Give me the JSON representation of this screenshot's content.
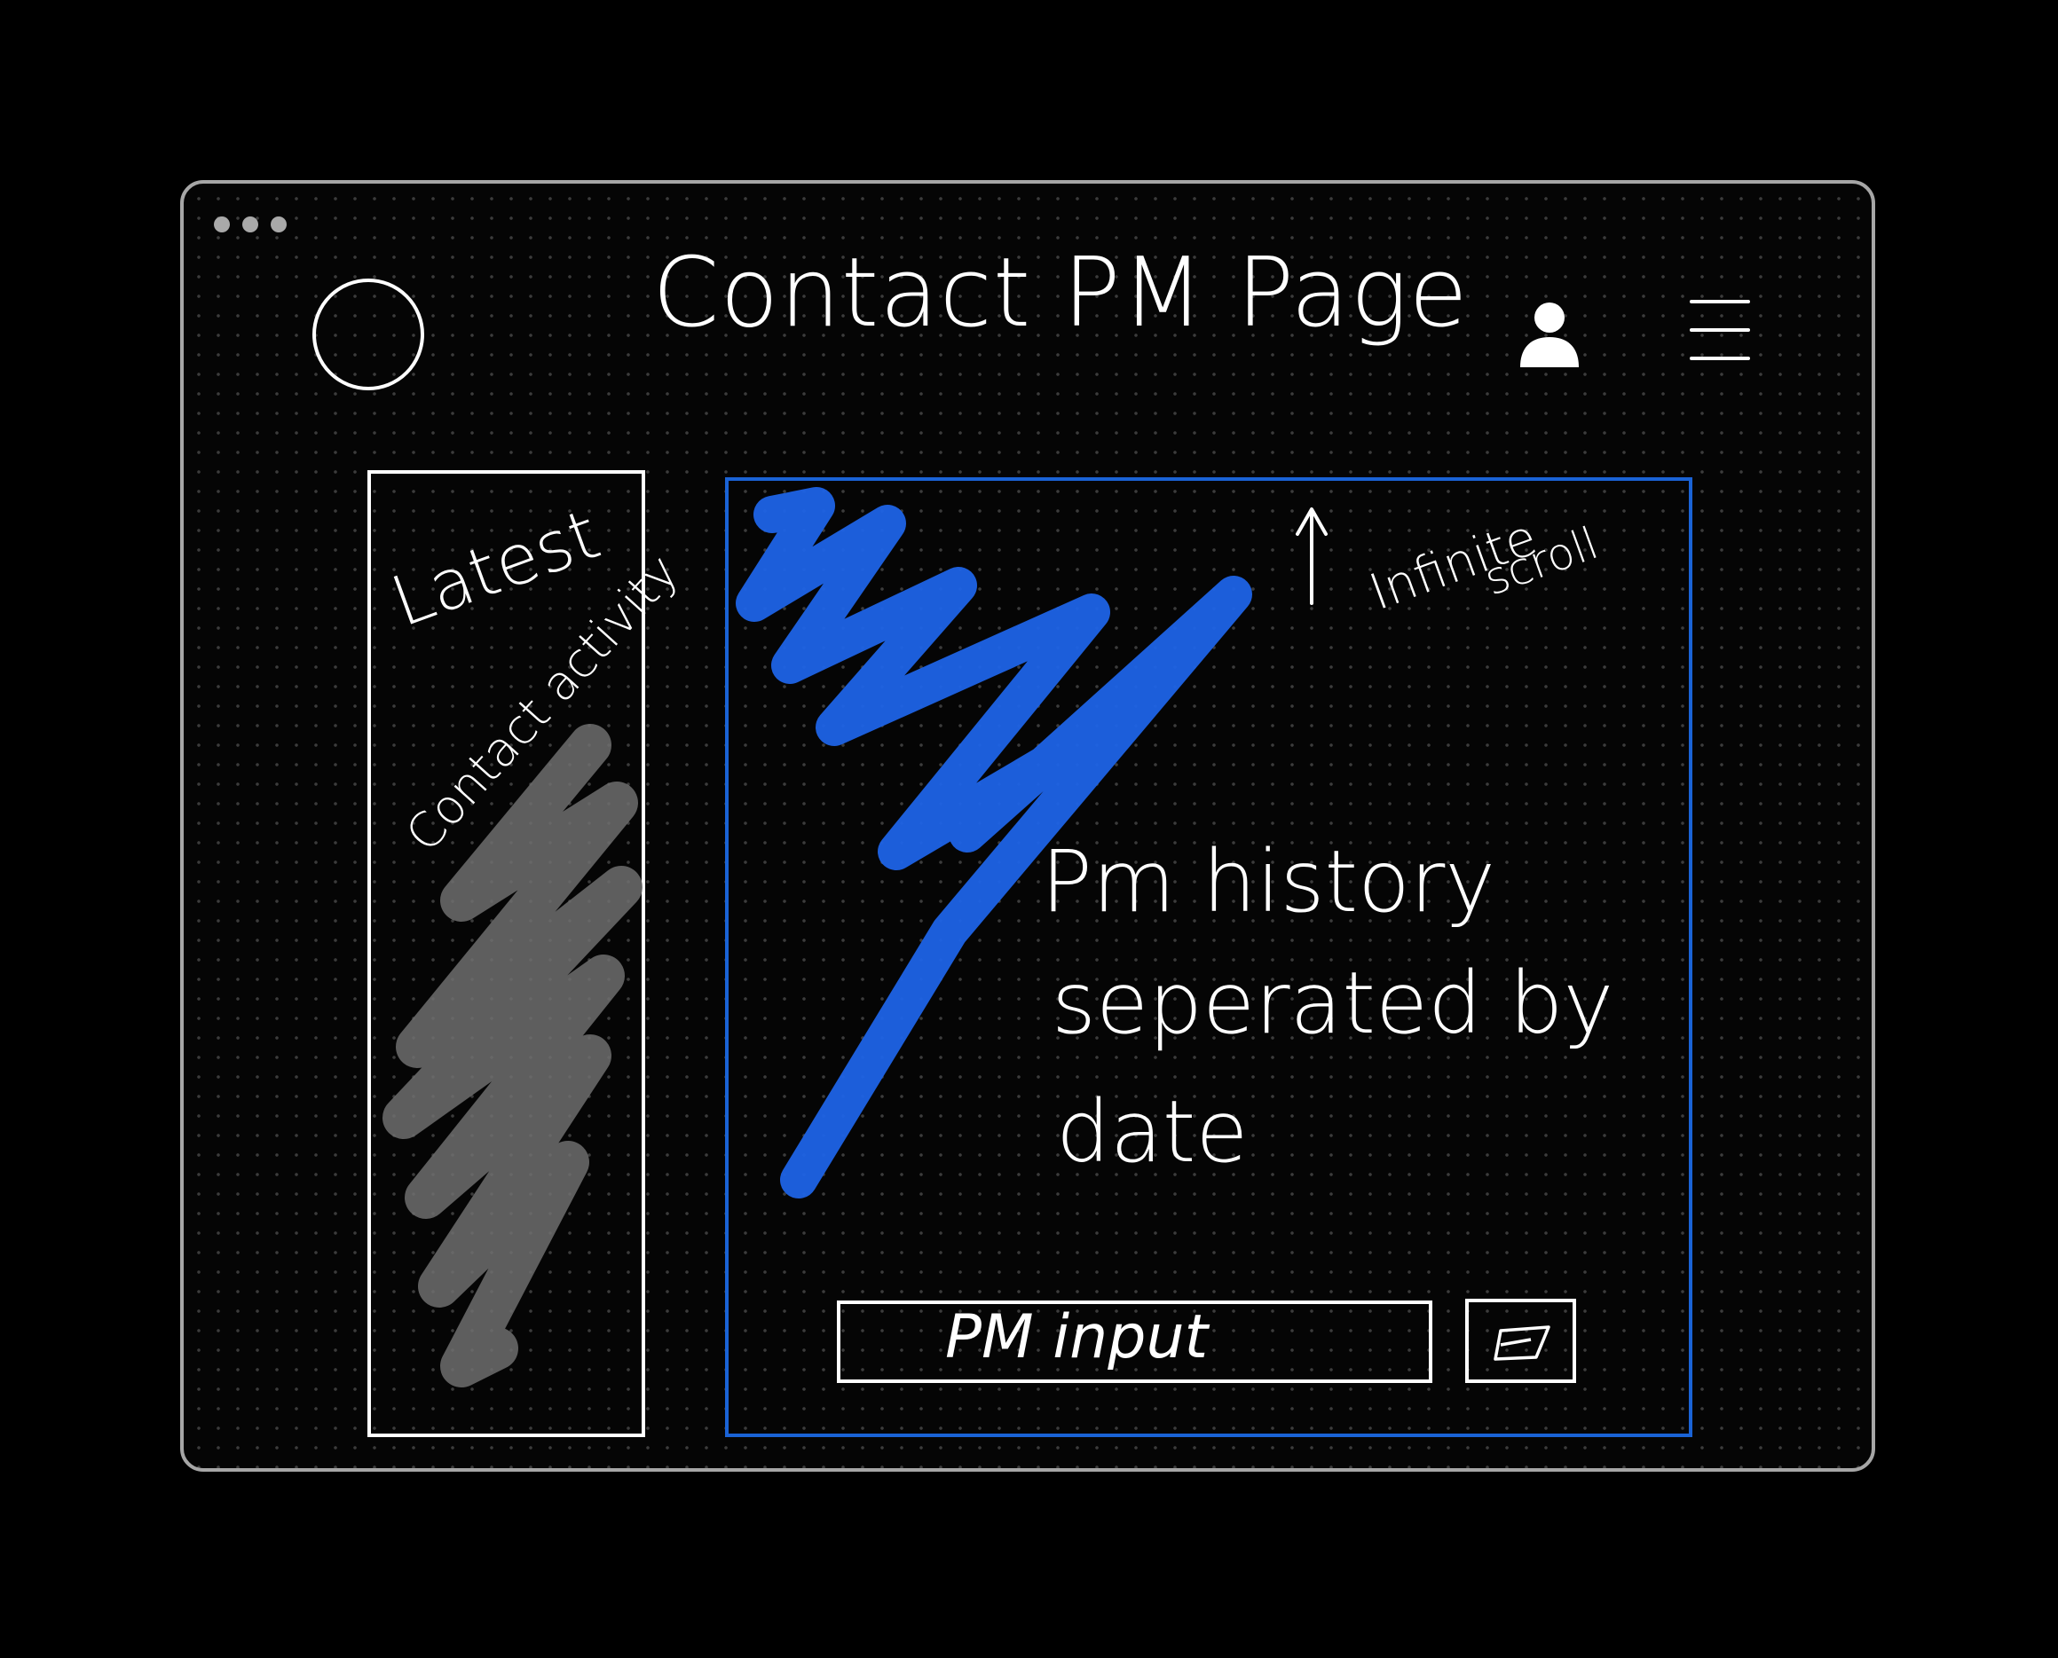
{
  "window": {
    "controls": [
      "window-dot",
      "window-dot",
      "window-dot"
    ]
  },
  "header": {
    "title": "Contact PM Page",
    "logo_icon": "circle-logo-icon",
    "profile_icon": "user-icon",
    "menu_icon": "hamburger-menu-icon"
  },
  "activity": {
    "heading": "Latest",
    "subheading": "Contact activity"
  },
  "history": {
    "line_1": "Pm history",
    "line_2": "seperated by",
    "line_3": "date",
    "scroll_note_1": "Infinite",
    "scroll_note_2": "scroll",
    "scroll_icon": "arrow-up-icon"
  },
  "composer": {
    "input_label": "PM input",
    "send_icon": "send-icon"
  },
  "colors": {
    "background": "#000000",
    "frame_border": "#a6a6a6",
    "accent_blue": "#1a63d6",
    "scribble_blue": "#1e63e6",
    "scribble_gray": "#6e6e6e",
    "stroke": "#ffffff"
  }
}
